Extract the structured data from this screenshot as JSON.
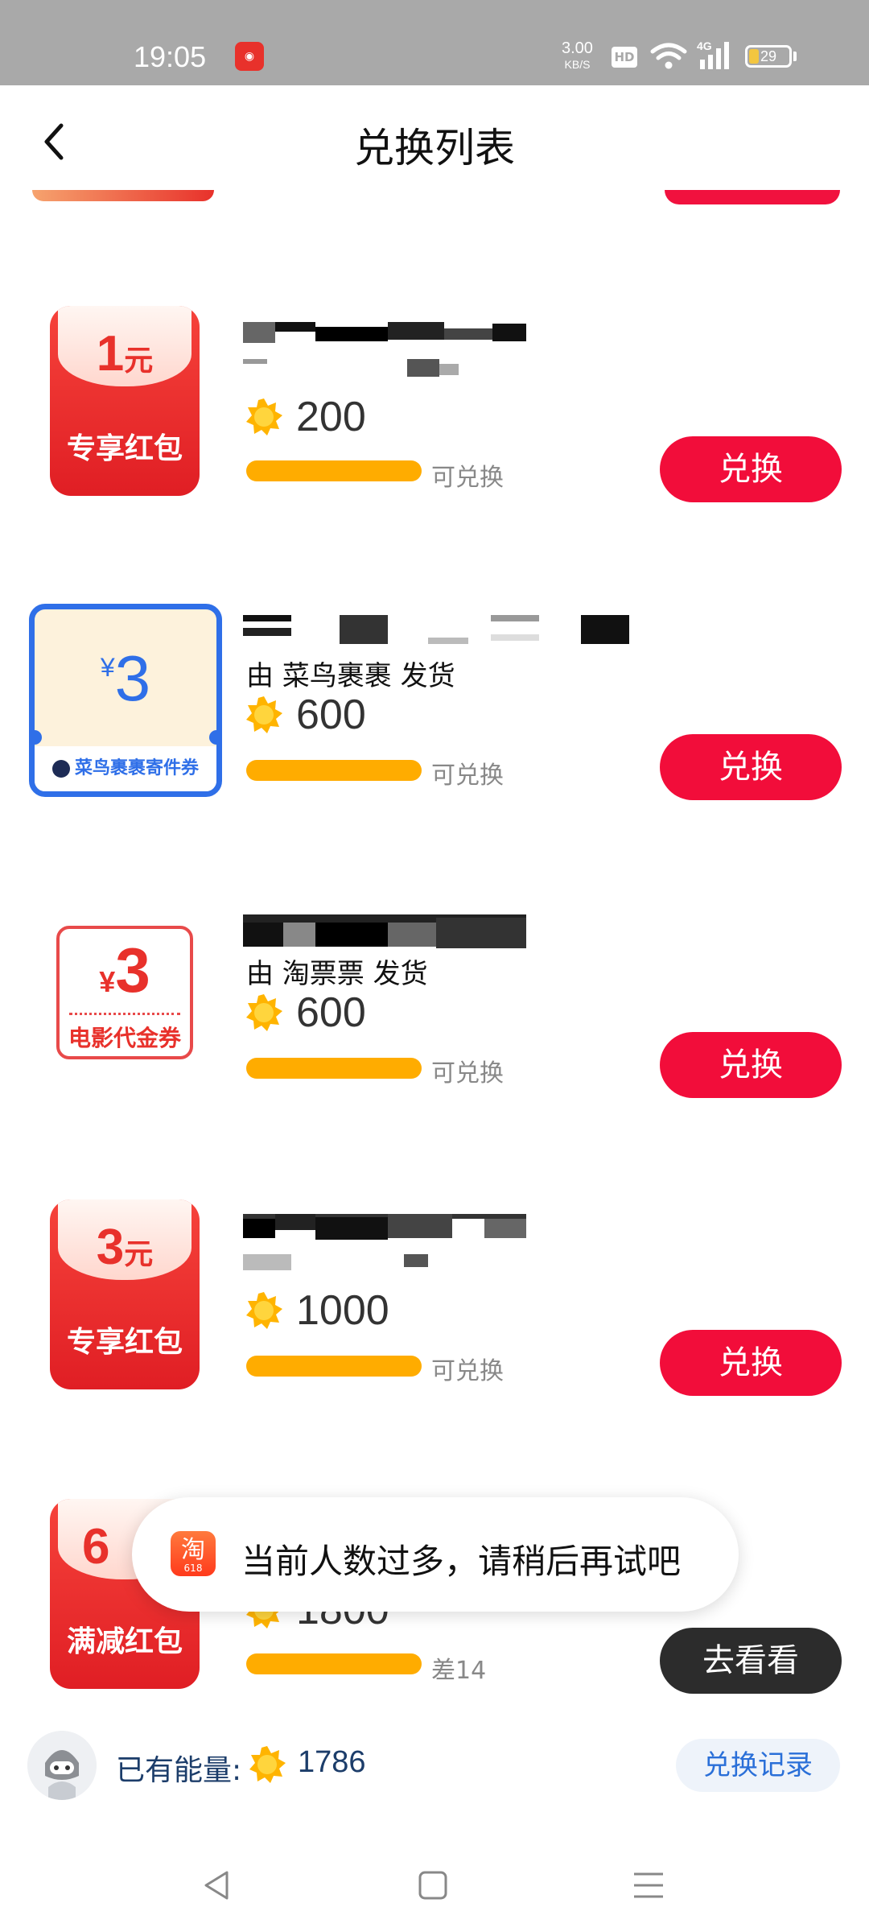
{
  "status_bar": {
    "time": "19:05",
    "net_speed_value": "3.00",
    "net_speed_unit": "KB/S",
    "hd_label": "HD",
    "signal_label": "4G",
    "battery": "29"
  },
  "header": {
    "title": "兑换列表"
  },
  "items": [
    {
      "thumb_amount": "1",
      "thumb_unit": "元",
      "thumb_label": "专享红包",
      "sender": "",
      "price": "200",
      "status": "可兑换",
      "button": "兑换"
    },
    {
      "thumb_currency": "¥",
      "thumb_amount": "3",
      "thumb_label": "菜鸟裹裹寄件券",
      "sender": "由 菜鸟裹裹 发货",
      "price": "600",
      "status": "可兑换",
      "button": "兑换"
    },
    {
      "thumb_currency": "¥",
      "thumb_amount": "3",
      "thumb_label": "电影代金券",
      "sender": "由 淘票票 发货",
      "price": "600",
      "status": "可兑换",
      "button": "兑换"
    },
    {
      "thumb_amount": "3",
      "thumb_unit": "元",
      "thumb_label": "专享红包",
      "sender": "",
      "price": "1000",
      "status": "可兑换",
      "button": "兑换"
    },
    {
      "thumb_amount": "6",
      "thumb_label": "满减红包",
      "price": "1800",
      "status": "差14",
      "button": "去看看"
    }
  ],
  "toast": {
    "icon_text": "淘",
    "icon_sub": "618",
    "message": "当前人数过多，请稍后再试吧"
  },
  "footer": {
    "have_label": "已有能量:",
    "have_value": "1786",
    "record_button": "兑换记录"
  },
  "colors": {
    "accent_red": "#f20d3a",
    "progress": "#ffac00",
    "link_blue": "#2a6fd8"
  }
}
